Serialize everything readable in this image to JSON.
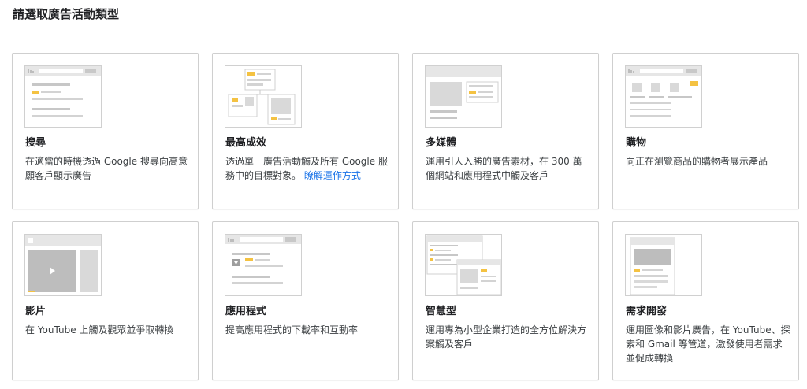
{
  "page_title": "請選取廣告活動類型",
  "colors": {
    "accent": "#f4c242",
    "placeholder": "#d9d9d9",
    "border": "#cfcfcf",
    "link": "#1a73e8"
  },
  "cards": [
    {
      "id": "search",
      "icon": "search-thumbnail-icon",
      "title": "搜尋",
      "desc": "在適當的時機透過 Google 搜尋向高意願客戶顯示廣告"
    },
    {
      "id": "performance-max",
      "icon": "performance-max-thumbnail-icon",
      "title": "最高成效",
      "desc": "透過單一廣告活動觸及所有 Google 服務中的目標對象。",
      "link": "瞭解運作方式"
    },
    {
      "id": "display",
      "icon": "display-thumbnail-icon",
      "title": "多媒體",
      "desc": "運用引人入勝的廣告素材，在 300 萬個網站和應用程式中觸及客戶"
    },
    {
      "id": "shopping",
      "icon": "shopping-thumbnail-icon",
      "title": "購物",
      "desc": "向正在瀏覽商品的購物者展示產品"
    },
    {
      "id": "video",
      "icon": "video-thumbnail-icon",
      "title": "影片",
      "desc": "在 YouTube 上觸及觀眾並爭取轉換"
    },
    {
      "id": "app",
      "icon": "app-thumbnail-icon",
      "title": "應用程式",
      "desc": "提高應用程式的下載率和互動率"
    },
    {
      "id": "smart",
      "icon": "smart-thumbnail-icon",
      "title": "智慧型",
      "desc": "運用專為小型企業打造的全方位解決方案觸及客戶"
    },
    {
      "id": "demand-gen",
      "icon": "demand-gen-thumbnail-icon",
      "title": "需求開發",
      "desc": "運用圖像和影片廣告，在 YouTube、探索和 Gmail 等管道，激發使用者需求並促成轉換"
    }
  ]
}
